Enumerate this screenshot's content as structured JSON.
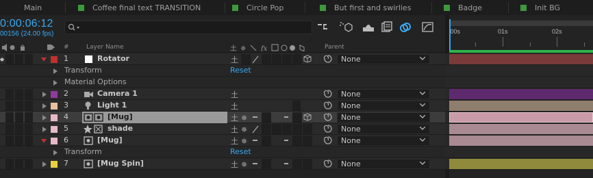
{
  "tabs": [
    "Main",
    "Coffee final text TRANSITION",
    "Circle Pop",
    "But first and swirlies",
    "Badge",
    "Init BG"
  ],
  "time": {
    "timecode": "0:00:06:12",
    "frames": "00156 (24.00 fps)"
  },
  "ruler": {
    "labels": [
      "0:00s",
      "01s",
      "02s"
    ]
  },
  "columns": {
    "hash": "#",
    "layer_name": "Layer Name",
    "parent": "Parent"
  },
  "colors": {
    "timecode": "#3aa7f0",
    "label_red": "#c03030",
    "label_purple": "#8e3a9e",
    "label_peach": "#e8c0a0",
    "label_pink": "#e7b9c8",
    "label_yellow": "#e8d044",
    "bar_red": "#7a3a3a",
    "bar_purple": "#5e2a6e",
    "bar_tan": "#8f7d6e",
    "bar_pink": "#c99aa8",
    "bar_pink2": "#a98a92",
    "bar_olive": "#8f8a3c"
  },
  "layers": [
    {
      "num": "1",
      "name": "Rotator",
      "icon": "null-object-icon",
      "parent": "None"
    },
    {
      "sub": "Transform",
      "reset": "Reset"
    },
    {
      "sub": "Material Options"
    },
    {
      "num": "2",
      "name": "Camera 1",
      "icon": "camera-icon",
      "parent": "None"
    },
    {
      "num": "3",
      "name": "Light 1",
      "icon": "light-bulb-icon",
      "parent": "None"
    },
    {
      "num": "4",
      "name": "[Mug]",
      "icon": "precomp-icon",
      "parent": "None"
    },
    {
      "num": "5",
      "name": "shade",
      "icon": "shape-layer-icon",
      "parent": "None"
    },
    {
      "num": "6",
      "name": "[Mug]",
      "icon": "precomp-icon",
      "parent": "None"
    },
    {
      "sub": "Transform",
      "reset": "Reset"
    },
    {
      "num": "7",
      "name": "[Mug Spin]",
      "icon": "precomp-icon",
      "parent": "None"
    }
  ]
}
